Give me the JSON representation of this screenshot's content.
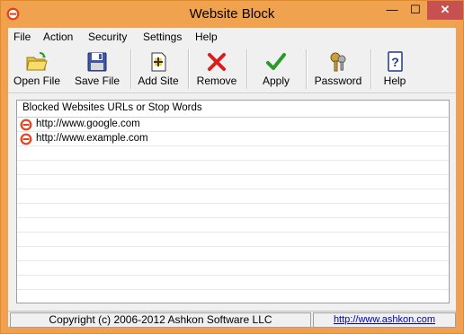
{
  "window": {
    "title": "Website Block",
    "controls": {
      "minimize": "—",
      "maximize": "☐",
      "close": "✕"
    }
  },
  "menu": [
    "File",
    "Action",
    "Security",
    "Settings",
    "Help"
  ],
  "toolbar": {
    "open_file": "Open File",
    "save_file": "Save File",
    "add_site": "Add Site",
    "remove": "Remove",
    "apply": "Apply",
    "password": "Password",
    "help": "Help"
  },
  "list": {
    "header": "Blocked Websites URLs or Stop Words",
    "items": [
      "http://www.google.com",
      "http://www.example.com"
    ]
  },
  "status": {
    "copyright": "Copyright (c) 2006-2012 Ashkon Software LLC",
    "link": "http://www.ashkon.com"
  },
  "colors": {
    "titlebar": "#f0a24f",
    "close_button": "#c75050",
    "link": "#0000cc",
    "block_icon": "#e8401c"
  }
}
